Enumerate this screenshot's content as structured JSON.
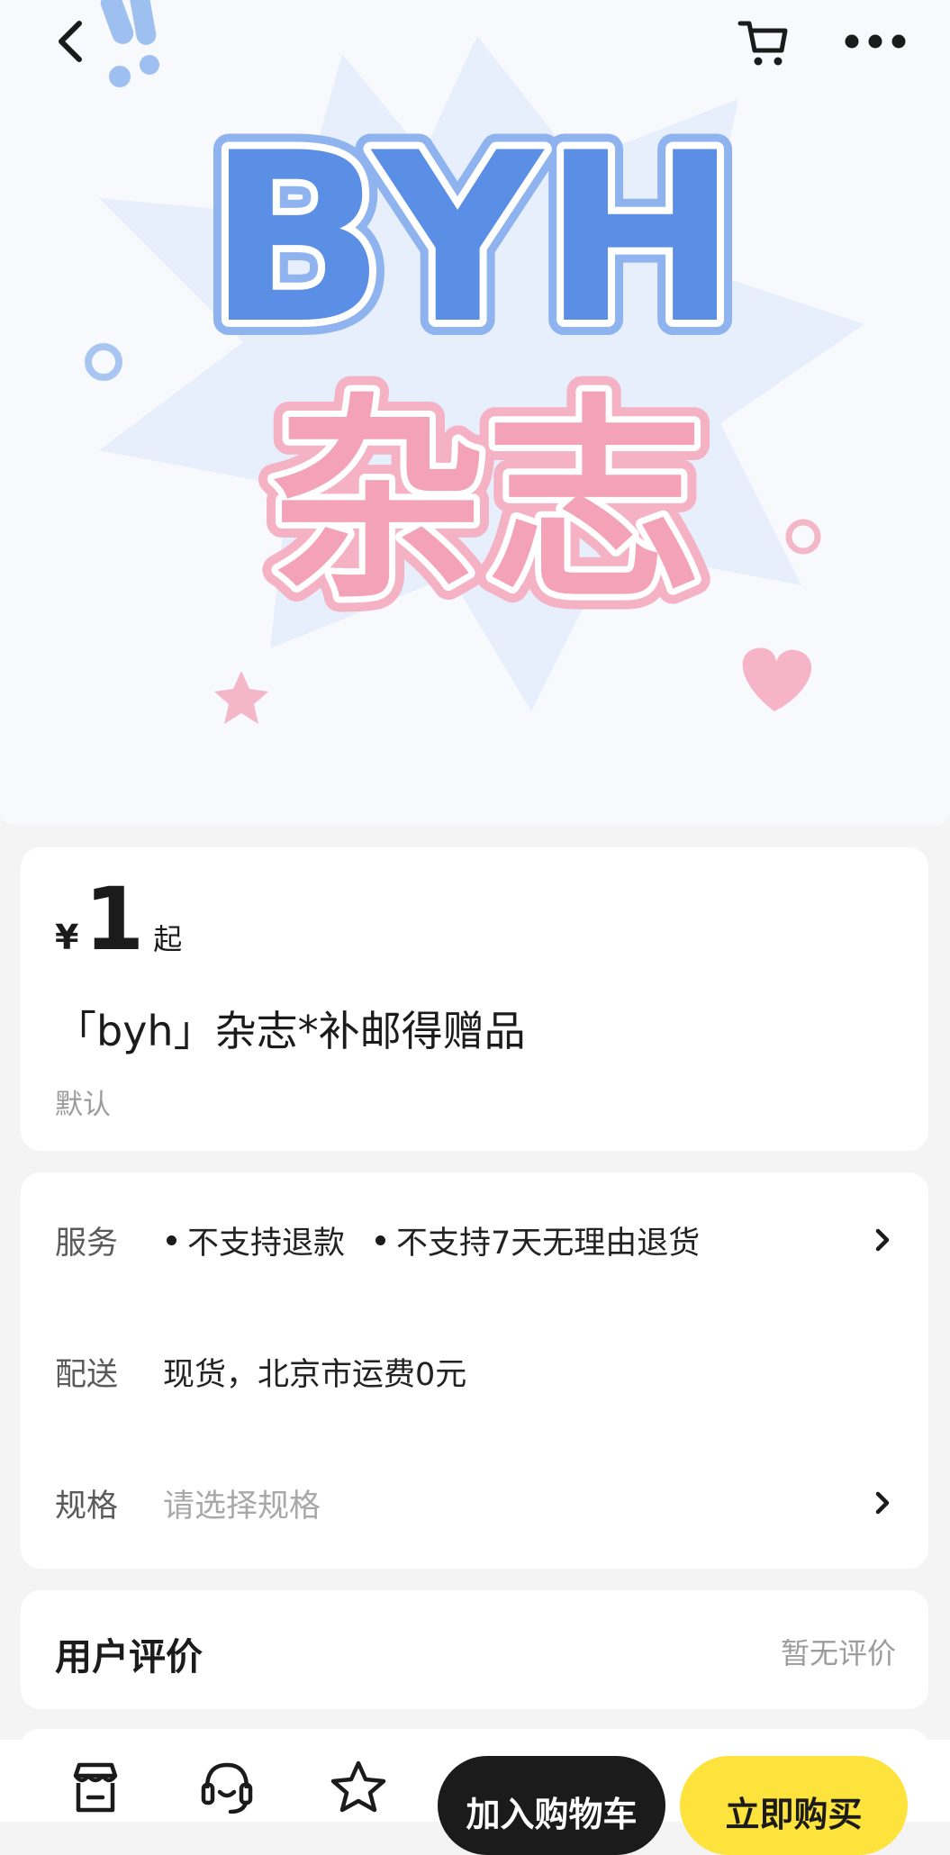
{
  "hero": {
    "logo_latin": "BYH",
    "logo_chinese": "杂志"
  },
  "top_nav": {
    "back_icon": "chevron-left-icon",
    "cart_icon": "cart-icon",
    "more_icon": "more-dots-icon"
  },
  "product": {
    "currency": "¥",
    "price": "1",
    "price_suffix": "起",
    "title": "「byh」杂志*补邮得赠品",
    "default_spec": "默认"
  },
  "details": {
    "service_label": "服务",
    "service_tags": [
      "不支持退款",
      "不支持7天无理由退货"
    ],
    "delivery_label": "配送",
    "delivery_value": "现货，北京市运费0元",
    "spec_label": "规格",
    "spec_placeholder": "请选择规格"
  },
  "reviews": {
    "title": "用户评价",
    "empty_text": "暂无评价"
  },
  "bottom_bar": {
    "shop_icon": "store-icon",
    "service_icon": "headset-icon",
    "favorite_icon": "star-icon",
    "add_to_cart": "加入购物车",
    "buy_now": "立即购买"
  },
  "colors": {
    "accent_yellow": "#fde33b",
    "dark": "#1b1b1b",
    "logo_blue": "#5b8fe6",
    "logo_pink": "#f3a2b8"
  }
}
